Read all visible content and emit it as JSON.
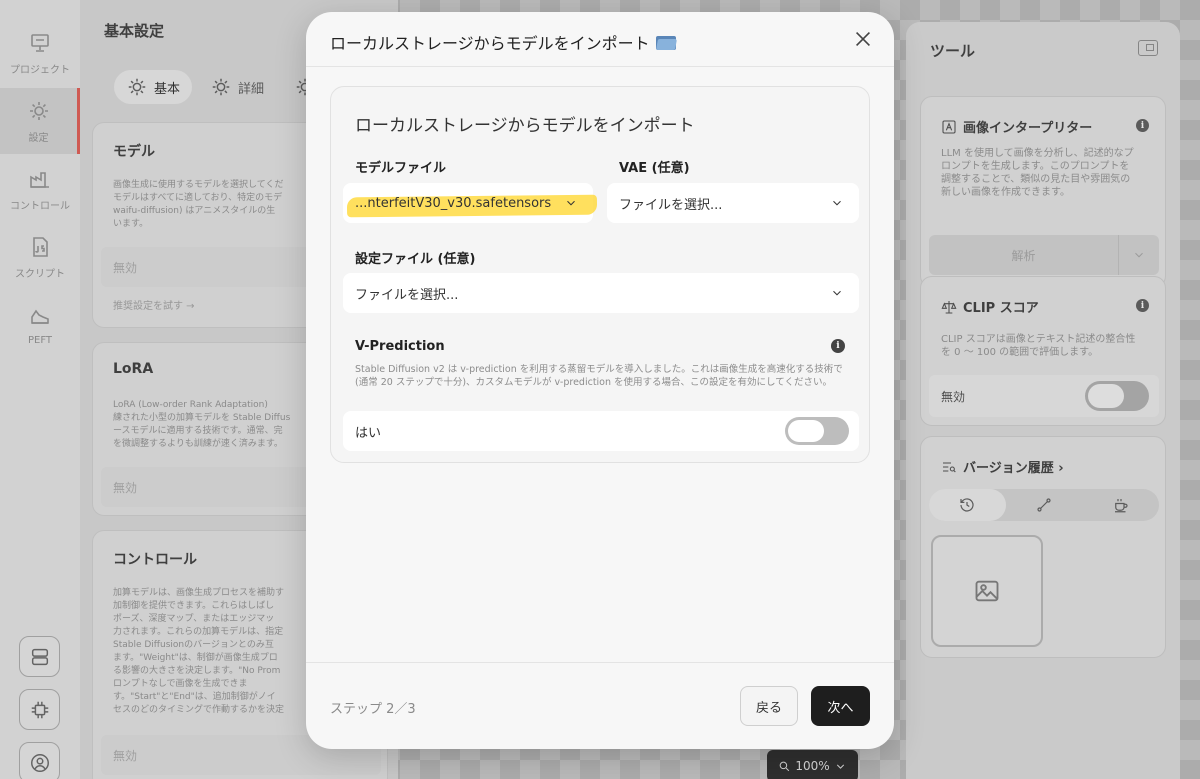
{
  "rail": {
    "items": [
      {
        "label": "プロジェクト"
      },
      {
        "label": "設定"
      },
      {
        "label": "コントロール"
      },
      {
        "label": "スクリプト"
      },
      {
        "label": "PEFT"
      }
    ]
  },
  "settings": {
    "title": "基本設定",
    "tabs": [
      {
        "label": "基本"
      },
      {
        "label": "詳細"
      }
    ],
    "model_card": {
      "title": "モデル",
      "desc": "画像生成に使用するモデルを選択してくだ\nモデルはすべてに適しており、特定のモデ\nwaifu-diffusion) はアニメスタイルの生\nいます。",
      "select_value": "無効",
      "link": "推奨設定を試す →"
    },
    "lora_card": {
      "title": "LoRA",
      "desc": "LoRA (Low-order Rank Adaptation) \n練された小型の加算モデルを Stable Diffus\nースモデルに適用する技術です。通常、完\nを微調整するよりも訓練が速く済みます。",
      "select_value": "無効"
    },
    "control_card": {
      "title": "コントロール",
      "desc": "加算モデルは、画像生成プロセスを補助す\n加制御を提供できます。これらはしばし\nポーズ、深度マップ、またはエッジマッ\n力されます。これらの加算モデルは、指定\nStable Diffusionのバージョンとのみ互\nます。\"Weight\"は、制御が画像生成プロ\nる影響の大きさを決定します。\"No Prom\nロンプトなしで画像を生成できま\nす。\"Start\"と\"End\"は、追加制御がノイ\nセスのどのタイミングで作動するかを決定",
      "select_value": "無効"
    }
  },
  "tools": {
    "title": "ツール",
    "interpreter": {
      "title": "画像インタープリター",
      "desc": "LLM を使用して画像を分析し、記述的なプ\nロンプトを生成します。このプロンプトを\n調整することで、類似の見た目や雰囲気の\n新しい画像を作成できます。",
      "button": "解析"
    },
    "clip": {
      "title": "CLIP スコア",
      "desc": "CLIP スコアは画像とテキスト記述の整合性\nを 0 〜 100 の範囲で評価します。",
      "row_label": "無効"
    },
    "history": {
      "title": "バージョン履歴 ›"
    }
  },
  "zoom": {
    "value": "100%"
  },
  "modal": {
    "title": "ローカルストレージからモデルをインポート",
    "heading": "ローカルストレージからモデルをインポート",
    "model_file": {
      "label": "モデルファイル",
      "value": "...nterfeitV30_v30.safetensors"
    },
    "vae": {
      "label": "VAE (任意)",
      "value": "ファイルを選択..."
    },
    "config": {
      "label": "設定ファイル (任意)",
      "value": "ファイルを選択..."
    },
    "vprediction": {
      "title": "V-Prediction",
      "desc": "Stable Diffusion v2 は v-prediction を利用する蒸留モデルを導入しました。これは画像生成を高速化する技術で (通常 20 ステップで十分)、カスタムモデルが v-prediction を使用する場合、この設定を有効にしてください。",
      "row_label": "はい",
      "enabled": false
    },
    "step": "ステップ 2／3",
    "back": "戻る",
    "next": "次へ"
  },
  "colors": {
    "highlight": "#ffd628",
    "primary_button": "#1e1e1e",
    "active_rail_marker": "#e2534b"
  }
}
